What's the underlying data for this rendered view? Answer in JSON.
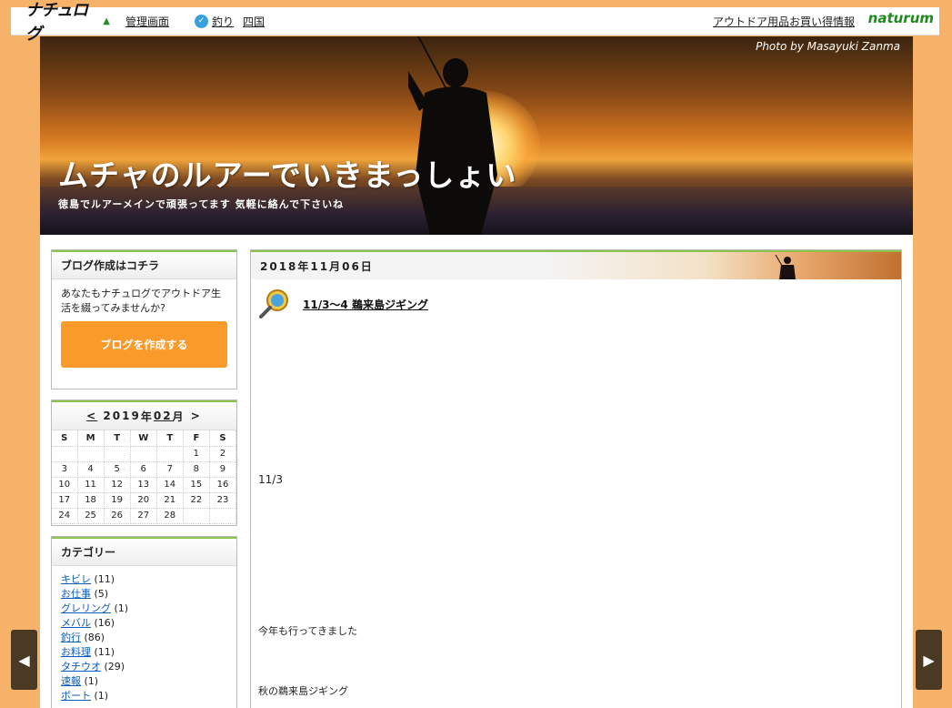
{
  "topbar": {
    "logo_text": "ナチュログ",
    "admin_link": "管理画面",
    "category_link": "釣り",
    "region_link": "四国",
    "outdoor_link": "アウトドア用品お買い得情報",
    "brand": "naturum"
  },
  "header": {
    "photo_credit": "Photo by Masayuki Zanma",
    "title": "ムチャのルアーでいきまっしょい",
    "subtitle": "徳島でルアーメインで頑張ってます 気軽に絡んで下さいね"
  },
  "sidebar": {
    "create": {
      "heading": "ブログ作成はコチラ",
      "text": "あなたもナチュログでアウトドア生活を綴ってみませんか?",
      "button": "ブログを作成する"
    },
    "calendar": {
      "prev": "<",
      "year": "2019",
      "year_suffix": "年",
      "month": "02",
      "month_suffix": "月",
      "next": ">",
      "dow": [
        "S",
        "M",
        "T",
        "W",
        "T",
        "F",
        "S"
      ],
      "weeks": [
        [
          "",
          "",
          "",
          "",
          "",
          "1",
          "2"
        ],
        [
          "3",
          "4",
          "5",
          "6",
          "7",
          "8",
          "9"
        ],
        [
          "10",
          "11",
          "12",
          "13",
          "14",
          "15",
          "16"
        ],
        [
          "17",
          "18",
          "19",
          "20",
          "21",
          "22",
          "23"
        ],
        [
          "24",
          "25",
          "26",
          "27",
          "28",
          "",
          ""
        ]
      ]
    },
    "categories": {
      "heading": "カテゴリー",
      "items": [
        {
          "name": "キビレ",
          "count": "(11)"
        },
        {
          "name": "お仕事",
          "count": "(5)"
        },
        {
          "name": "グレリング",
          "count": "(1)"
        },
        {
          "name": "メバル",
          "count": "(16)"
        },
        {
          "name": "釣行",
          "count": "(86)"
        },
        {
          "name": "お料理",
          "count": "(11)"
        },
        {
          "name": "タチウオ",
          "count": "(29)"
        },
        {
          "name": "速報",
          "count": "(1)"
        },
        {
          "name": "ボート",
          "count": "(1)"
        }
      ]
    }
  },
  "main": {
    "date": "2018年11月06日",
    "entry_title": "11/3～4 鵜来島ジギング",
    "paragraphs": [
      "11/3",
      "今年も行ってきました",
      "秋の鵜来島ジギング"
    ]
  },
  "nav": {
    "left_icon": "arrow-left-icon",
    "right_icon": "arrow-right-icon"
  }
}
